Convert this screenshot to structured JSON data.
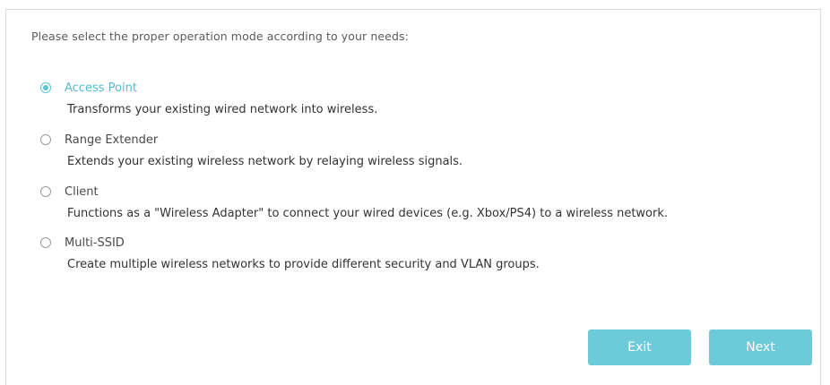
{
  "wizard": {
    "prompt": "Please select the proper operation mode according to your needs:",
    "modes": [
      {
        "label": "Access Point",
        "description": "Transforms your existing wired network into wireless.",
        "selected": true
      },
      {
        "label": "Range Extender",
        "description": "Extends your existing wireless network by relaying wireless signals.",
        "selected": false
      },
      {
        "label": "Client",
        "description": "Functions as a \"Wireless Adapter\" to connect your wired devices (e.g. Xbox/PS4) to a wireless network.",
        "selected": false
      },
      {
        "label": "Multi-SSID",
        "description": "Create multiple wireless networks to provide different security and VLAN groups.",
        "selected": false
      }
    ],
    "exit_label": "Exit",
    "next_label": "Next"
  },
  "colors": {
    "accent": "#59c5d4",
    "button": "#6dcad8"
  }
}
